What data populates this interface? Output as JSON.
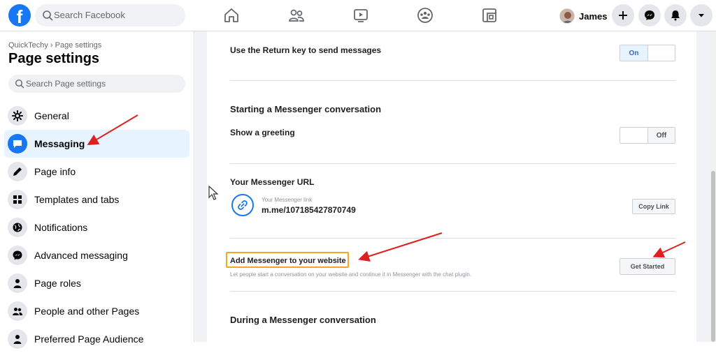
{
  "header": {
    "logo_letter": "f",
    "search_placeholder": "Search Facebook",
    "nav_icons": [
      "home-icon",
      "friends-icon",
      "watch-icon",
      "groups-icon",
      "gaming-icon"
    ],
    "profile_name": "James",
    "action_icons": [
      "plus-icon",
      "messenger-icon",
      "notifications-icon",
      "dropdown-icon"
    ]
  },
  "sidebar": {
    "breadcrumb": "QuickTechy › Page settings",
    "title": "Page settings",
    "search_placeholder": "Search Page settings",
    "items": [
      {
        "label": "General",
        "icon": "gear-icon",
        "active": false
      },
      {
        "label": "Messaging",
        "icon": "messaging-icon",
        "active": true
      },
      {
        "label": "Page info",
        "icon": "pencil-icon",
        "active": false
      },
      {
        "label": "Templates and tabs",
        "icon": "grid-icon",
        "active": false
      },
      {
        "label": "Notifications",
        "icon": "globe-icon",
        "active": false
      },
      {
        "label": "Advanced messaging",
        "icon": "messenger-icon",
        "active": false
      },
      {
        "label": "Page roles",
        "icon": "person-icon",
        "active": false
      },
      {
        "label": "People and other Pages",
        "icon": "people-icon",
        "active": false
      },
      {
        "label": "Preferred Page Audience",
        "icon": "audience-icon",
        "active": false
      }
    ]
  },
  "main": {
    "return_key_label": "Use the Return key to send messages",
    "return_key_toggle": "On",
    "starting_section_title": "Starting a Messenger conversation",
    "show_greeting_label": "Show a greeting",
    "show_greeting_toggle": "Off",
    "messenger_url_title": "Your Messenger URL",
    "messenger_link_caption": "Your Messenger link",
    "messenger_link": "m.me/107185427870749",
    "copy_link_button": "Copy Link",
    "add_messenger_title": "Add Messenger to your website",
    "add_messenger_desc": "Let people start a conversation on your website and continue it in Messenger with the chat plugin.",
    "get_started_button": "Get Started",
    "during_section_title": "During a Messenger conversation"
  },
  "colors": {
    "brand": "#1877f2",
    "highlight_box": "#f5a623",
    "annotation_arrow": "#e02020"
  }
}
